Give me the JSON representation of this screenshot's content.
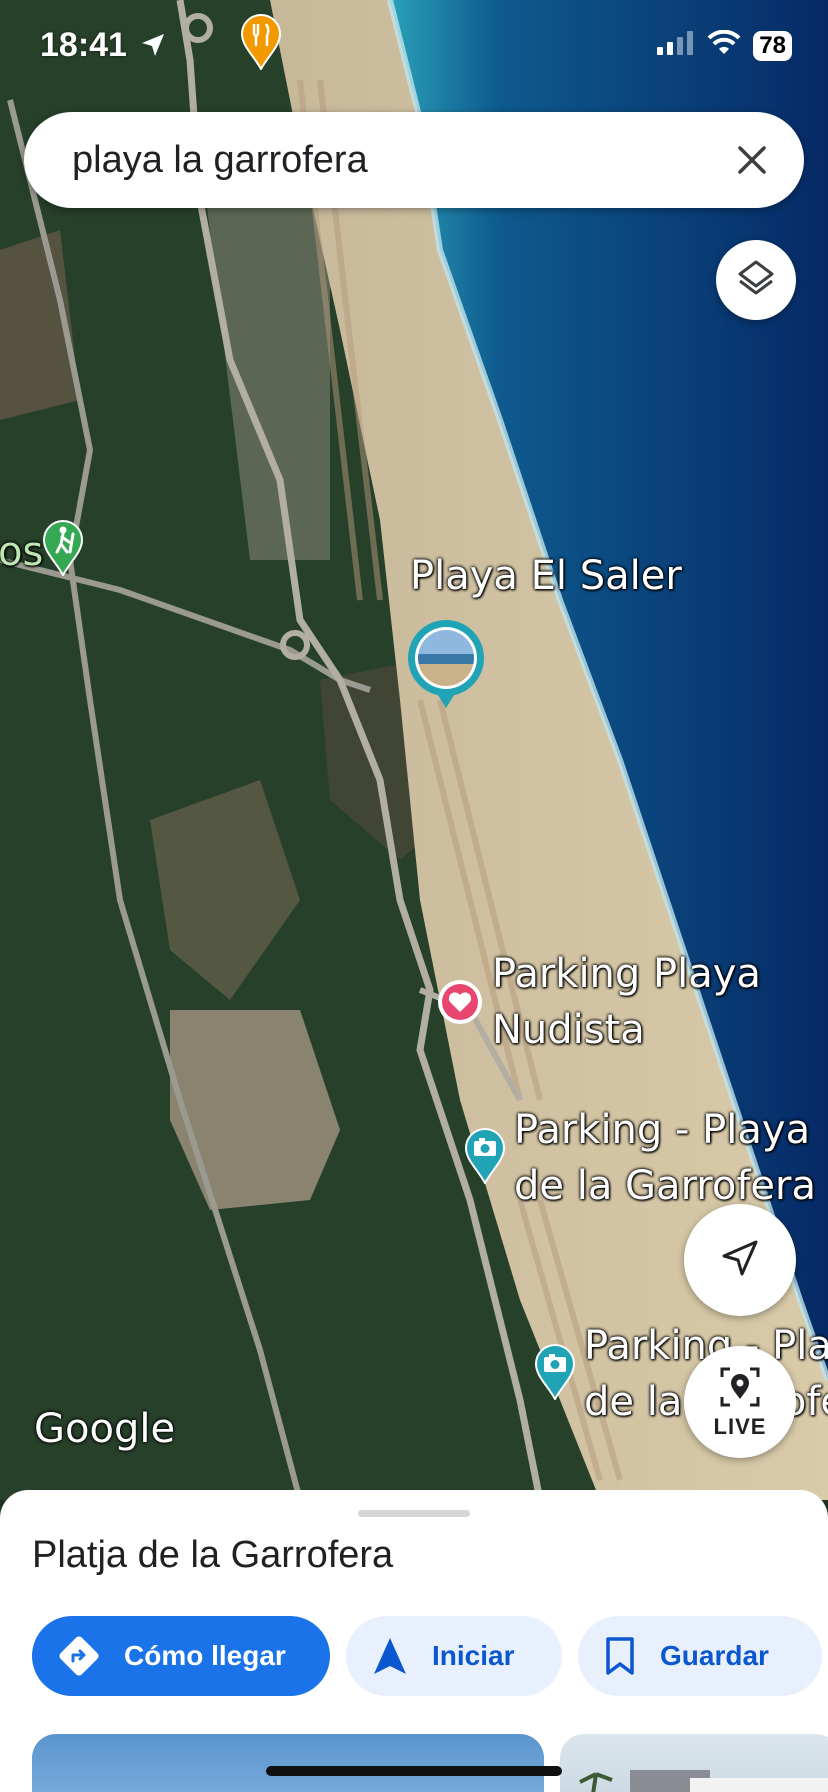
{
  "status_bar": {
    "time": "18:41",
    "battery": "78"
  },
  "search": {
    "query": "playa la garrofera"
  },
  "map": {
    "labels": {
      "playa_el_saler": "Playa El Saler",
      "parking_nudista_line1": "Parking Playa",
      "parking_nudista_line2": "Nudista",
      "parking_garrofera_line1": "Parking - Playa",
      "parking_garrofera_line2": "de la Garrofera",
      "parking_garrofera2_line1": "Parking - Pla",
      "parking_garrofera2_line2": "de la Garrofe",
      "left_edge_label": "os"
    },
    "live_label": "LIVE",
    "logo": "Google"
  },
  "sheet": {
    "title": "Platja de la Garrofera",
    "actions": {
      "directions": "Cómo llegar",
      "start": "Iniciar",
      "save": "Guardar"
    }
  },
  "colors": {
    "accent": "#1a73e8",
    "chip_bg": "#e8f0fe",
    "chip_text": "#0b57d0",
    "marker_teal": "#1fa3b5",
    "marker_pink": "#e8456f"
  },
  "icons": [
    "location-arrow-icon",
    "signal-icon",
    "wifi-icon",
    "battery-icon",
    "close-icon",
    "layers-icon",
    "hiking-icon",
    "restaurant-icon",
    "heart-icon",
    "camera-icon",
    "navigation-icon",
    "live-view-icon",
    "directions-icon",
    "start-navigation-icon",
    "bookmark-icon"
  ]
}
